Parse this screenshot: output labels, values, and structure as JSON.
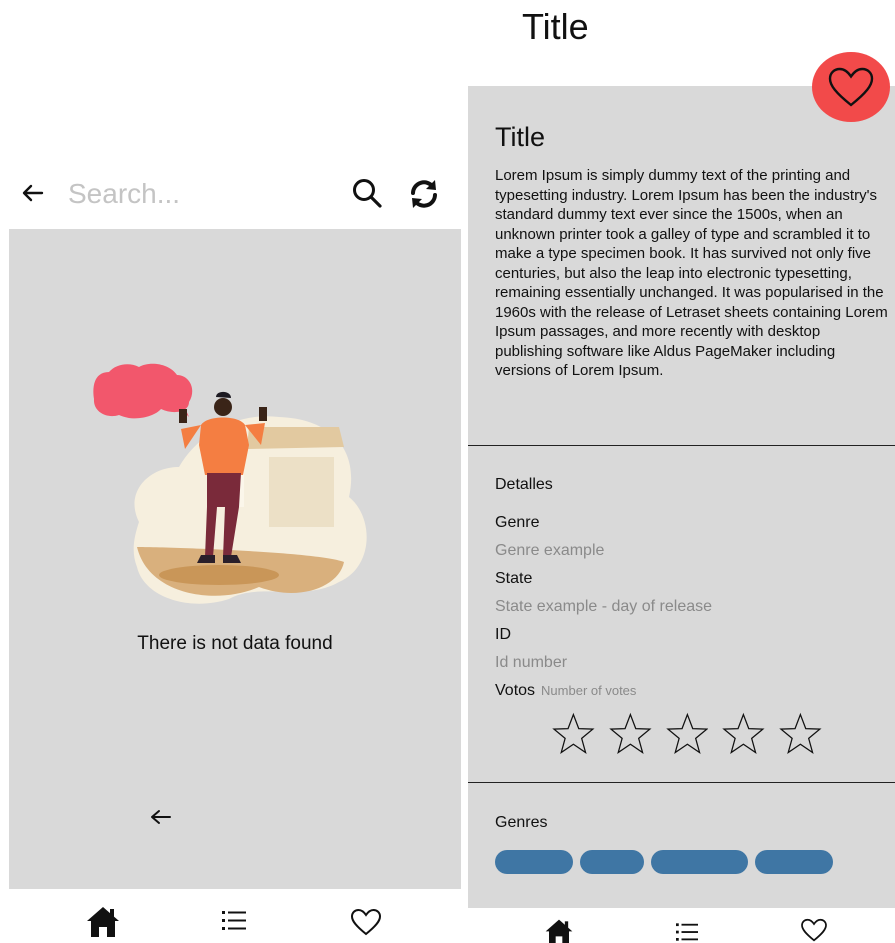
{
  "search": {
    "placeholder": "Search..."
  },
  "empty_state": {
    "message": "There is not data found"
  },
  "top_title": "Title",
  "detail": {
    "title": "Title",
    "description": "Lorem Ipsum is simply dummy text of the printing and typesetting industry. Lorem Ipsum has been the industry's standard dummy text ever since the 1500s, when an unknown printer took a galley of type and scrambled it to make a type specimen book. It has survived not only five centuries, but also the leap into electronic typesetting, remaining essentially unchanged. It was popularised in the 1960s with the release of Letraset sheets containing Lorem Ipsum passages, and more recently with desktop publishing software like Aldus PageMaker including versions of Lorem Ipsum.",
    "details_heading": "Detalles",
    "genre_label": "Genre",
    "genre_value": "Genre example",
    "state_label": "State",
    "state_value": "State example - day of release",
    "id_label": "ID",
    "id_value": "Id number",
    "votes_label": "Votos",
    "votes_value": "Number of votes",
    "rating_stars_filled": 0,
    "rating_stars_total": 5,
    "genres_heading": "Genres",
    "genre_chip_count": 4
  },
  "nav": {
    "items": [
      "home-icon",
      "list-icon",
      "heart-icon"
    ]
  },
  "colors": {
    "panel_bg": "#d9d9d9",
    "fab_red": "#f24a4a",
    "chip_blue": "#3f76a4",
    "muted_text": "#8a8a8a"
  }
}
